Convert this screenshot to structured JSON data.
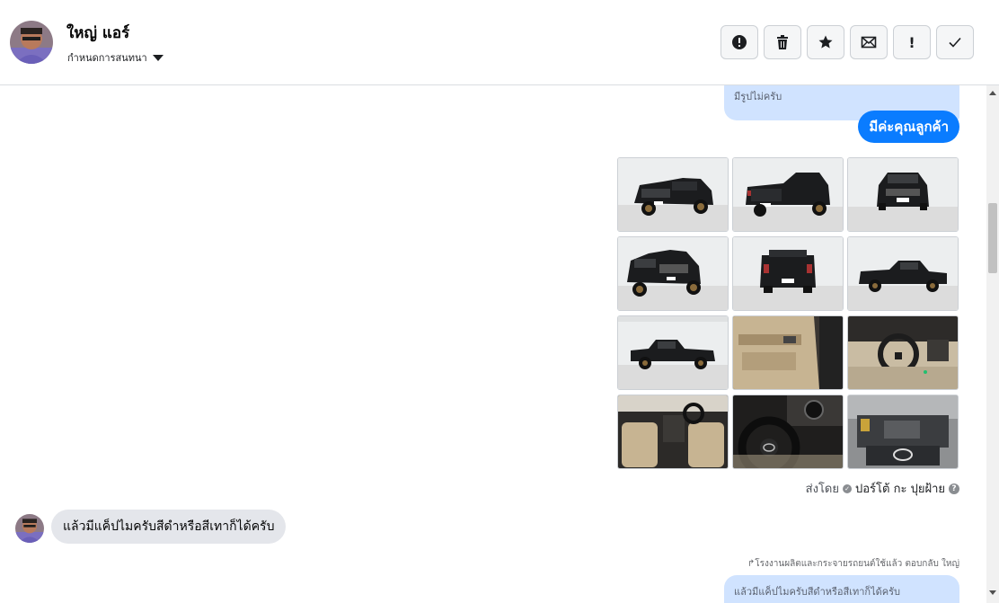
{
  "header": {
    "contact_name": "ใหญ่ แอร์",
    "assign_label": "กำหนดการสนทนา",
    "actions": [
      {
        "name": "mark-spam-button",
        "icon": "alert-circle-icon"
      },
      {
        "name": "delete-button",
        "icon": "trash-icon"
      },
      {
        "name": "star-button",
        "icon": "star-icon"
      },
      {
        "name": "mark-unread-button",
        "icon": "envelope-icon"
      },
      {
        "name": "follow-up-button",
        "icon": "exclamation-icon",
        "glyph": "!"
      },
      {
        "name": "mark-done-button",
        "icon": "checkmark-icon"
      }
    ]
  },
  "thread": {
    "quoted_top": "มีรูปไม่ครับ",
    "outgoing_message": "มีค่ะคุณลูกค้า",
    "photos": [
      {
        "alt": "truck-front-left"
      },
      {
        "alt": "truck-rear-right"
      },
      {
        "alt": "truck-front"
      },
      {
        "alt": "truck-front-left-2"
      },
      {
        "alt": "truck-rear"
      },
      {
        "alt": "truck-side"
      },
      {
        "alt": "truck-side-left"
      },
      {
        "alt": "door-panel"
      },
      {
        "alt": "dashboard"
      },
      {
        "alt": "interior-seats"
      },
      {
        "alt": "steering-wheel"
      },
      {
        "alt": "engine-bay"
      }
    ],
    "sent_by_label": "ส่งโดย",
    "sent_by_name": "ปอร์โต้ กะ ปุยฝ้าย",
    "incoming_message": "แล้วมีแค็ปไมครับสีดำหรือสีเทาก็ได้ครับ",
    "reply_meta": "↱โรงงานผลิตและกระจายรถยนต์ใช้แล้ว ตอบกลับ ใหญ่",
    "quoted_bottom": "แล้วมีแค็ปไมครับสีดำหรือสีเทาก็ได้ครับ"
  },
  "colors": {
    "accent": "#0a7cff",
    "quoted_bg": "#d0e3ff",
    "incoming_bg": "#e4e6eb",
    "vehicle_black": "#1a1b1d"
  }
}
